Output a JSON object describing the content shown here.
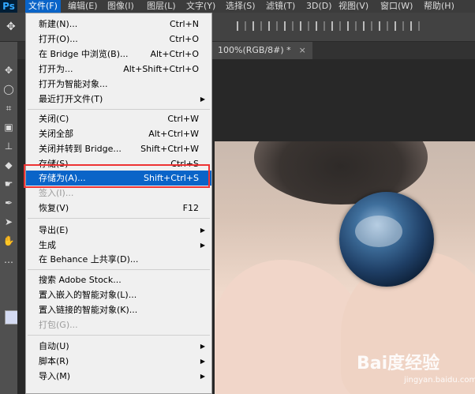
{
  "app": {
    "logo": "Ps"
  },
  "menubar": {
    "items": [
      "文件(F)",
      "编辑(E)",
      "图像(I)",
      "图层(L)",
      "文字(Y)",
      "选择(S)",
      "滤镜(T)",
      "3D(D)",
      "视图(V)",
      "窗口(W)",
      "帮助(H)"
    ]
  },
  "document_tab": {
    "label": "100%(RGB/8#) *",
    "close": "×"
  },
  "file_menu": {
    "items": [
      {
        "label": "新建(N)...",
        "shortcut": "Ctrl+N"
      },
      {
        "label": "打开(O)...",
        "shortcut": "Ctrl+O"
      },
      {
        "label": "在 Bridge 中浏览(B)...",
        "shortcut": "Alt+Ctrl+O"
      },
      {
        "label": "打开为...",
        "shortcut": "Alt+Shift+Ctrl+O"
      },
      {
        "label": "打开为智能对象...",
        "shortcut": ""
      },
      {
        "label": "最近打开文件(T)",
        "shortcut": ""
      },
      {
        "label": "关闭(C)",
        "shortcut": "Ctrl+W"
      },
      {
        "label": "关闭全部",
        "shortcut": "Alt+Ctrl+W"
      },
      {
        "label": "关闭并转到 Bridge...",
        "shortcut": "Shift+Ctrl+W"
      },
      {
        "label": "存储(S)",
        "shortcut": "Ctrl+S"
      },
      {
        "label": "存储为(A)...",
        "shortcut": "Shift+Ctrl+S"
      },
      {
        "label": "签入(I)...",
        "shortcut": ""
      },
      {
        "label": "恢复(V)",
        "shortcut": "F12"
      },
      {
        "label": "导出(E)",
        "shortcut": ""
      },
      {
        "label": "生成",
        "shortcut": ""
      },
      {
        "label": "在 Behance 上共享(D)...",
        "shortcut": ""
      },
      {
        "label": "搜索 Adobe Stock...",
        "shortcut": ""
      },
      {
        "label": "置入嵌入的智能对象(L)...",
        "shortcut": ""
      },
      {
        "label": "置入链接的智能对象(K)...",
        "shortcut": ""
      },
      {
        "label": "打包(G)...",
        "shortcut": ""
      },
      {
        "label": "自动(U)",
        "shortcut": ""
      },
      {
        "label": "脚本(R)",
        "shortcut": ""
      },
      {
        "label": "导入(M)",
        "shortcut": ""
      }
    ],
    "submenu_arrow": "▶"
  },
  "watermark": {
    "text": "Bai度经验",
    "sub": "jingyan.baidu.com"
  },
  "colors": {
    "highlight": "#0a64c8",
    "annotation": "#e33333"
  }
}
